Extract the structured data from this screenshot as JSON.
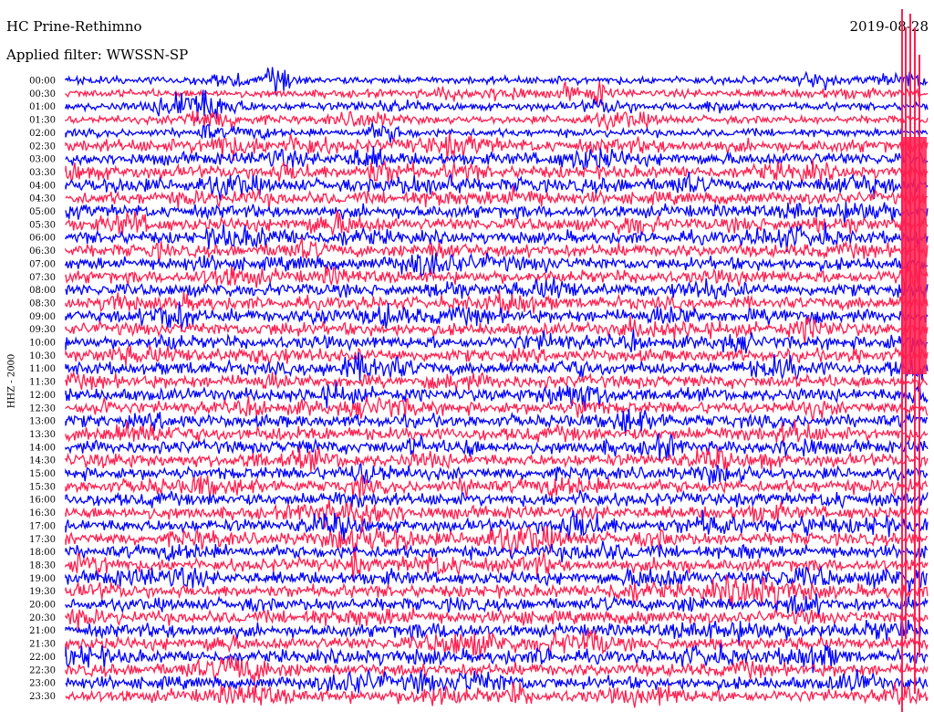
{
  "header": {
    "station": "HC Prine-Rethimno",
    "filter": "Applied filter: WWSSN-SP",
    "date": "2019-08-28"
  },
  "chart_data": {
    "type": "line",
    "title": "HC Prine-Rethimno",
    "ylabel": "HHZ - 2000",
    "x_range_minutes": [
      0,
      30
    ],
    "categories": [
      "00:00",
      "00:30",
      "01:00",
      "01:30",
      "02:00",
      "02:30",
      "03:00",
      "03:30",
      "04:00",
      "04:30",
      "05:00",
      "05:30",
      "06:00",
      "06:30",
      "07:00",
      "07:30",
      "08:00",
      "08:30",
      "09:00",
      "09:30",
      "10:00",
      "10:30",
      "11:00",
      "11:30",
      "12:00",
      "12:30",
      "13:00",
      "13:30",
      "14:00",
      "14:30",
      "15:00",
      "15:30",
      "16:00",
      "16:30",
      "17:00",
      "17:30",
      "18:00",
      "18:30",
      "19:00",
      "19:30",
      "20:00",
      "20:30",
      "21:00",
      "21:30",
      "22:00",
      "22:30",
      "23:00",
      "23:30"
    ],
    "series_colors": [
      "#0000ff",
      "#ff1f4f"
    ],
    "grid": false,
    "legend": "none"
  }
}
